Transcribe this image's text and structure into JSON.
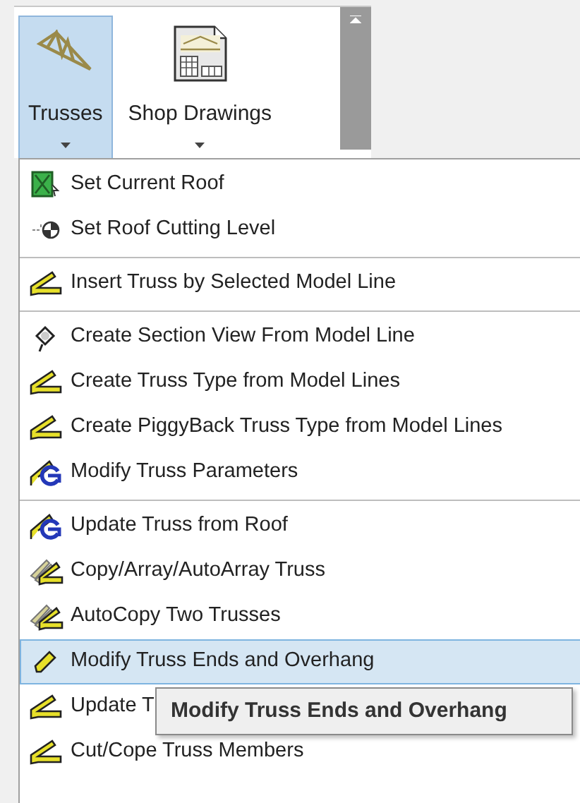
{
  "ribbon": {
    "buttons": [
      {
        "label": "Trusses",
        "kind": "truss",
        "selected": true
      },
      {
        "label": "Shop Drawings",
        "kind": "drawing",
        "selected": false
      }
    ]
  },
  "menu": {
    "groups": [
      [
        {
          "label": "Set Current Roof",
          "kind": "roof",
          "selected": false
        },
        {
          "label": "Set Roof Cutting Level",
          "kind": "level",
          "selected": false
        }
      ],
      [
        {
          "label": "Insert Truss by Selected Model Line",
          "kind": "chord",
          "selected": false
        }
      ],
      [
        {
          "label": "Create Section View From Model Line",
          "kind": "section",
          "selected": false
        },
        {
          "label": "Create Truss Type from Model Lines",
          "kind": "chord",
          "selected": false
        },
        {
          "label": "Create PiggyBack Truss Type from Model Lines",
          "kind": "chord",
          "selected": false
        },
        {
          "label": "Modify Truss Parameters",
          "kind": "params",
          "selected": false
        }
      ],
      [
        {
          "label": "Update Truss from Roof",
          "kind": "params",
          "selected": false
        },
        {
          "label": "Copy/Array/AutoArray Truss",
          "kind": "copy",
          "selected": false
        },
        {
          "label": "AutoCopy Two Trusses",
          "kind": "copy",
          "selected": false
        },
        {
          "label": "Modify Truss Ends and Overhang",
          "kind": "pencil",
          "selected": true
        },
        {
          "label": "Update T",
          "kind": "chord-small",
          "selected": false
        },
        {
          "label": "Cut/Cope Truss Members",
          "kind": "chord",
          "selected": false
        }
      ]
    ]
  },
  "tooltip": {
    "text": "Modify Truss Ends and Overhang"
  }
}
